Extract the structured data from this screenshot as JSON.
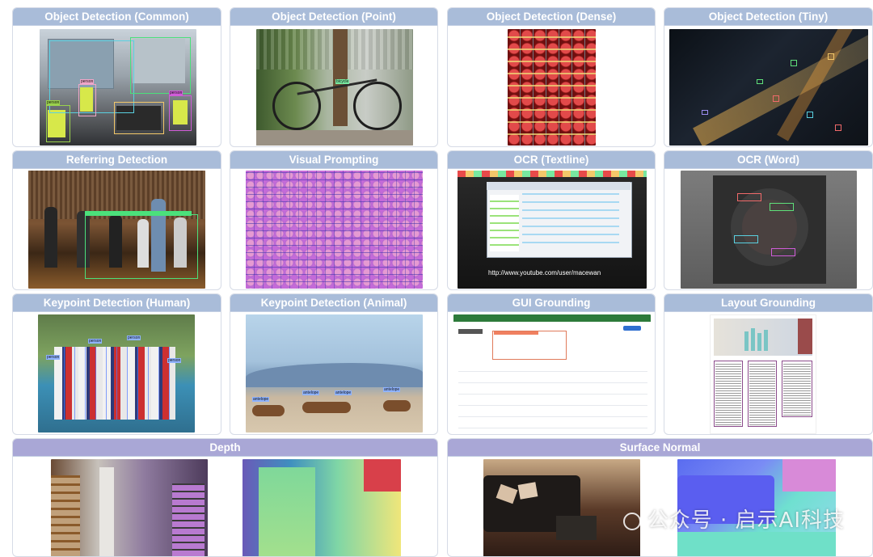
{
  "panels": {
    "obj_common": "Object Detection (Common)",
    "obj_point": "Object Detection (Point)",
    "obj_dense": "Object Detection (Dense)",
    "obj_tiny": "Object Detection (Tiny)",
    "referring": "Referring Detection",
    "visual_prompting": "Visual Prompting",
    "ocr_textline": "OCR (Textline)",
    "ocr_word": "OCR (Word)",
    "kp_human": "Keypoint Detection (Human)",
    "kp_animal": "Keypoint Detection (Animal)",
    "gui_grounding": "GUI Grounding",
    "layout_grounding": "Layout Grounding",
    "depth": "Depth",
    "surface_normal": "Surface Normal"
  },
  "labels": {
    "person": "person",
    "antelope": "antelope",
    "bicycle": "bicycle",
    "url": "http://www.youtube.com/user/macewan"
  },
  "watermark": "公众号 · 启示AI科技",
  "colors": {
    "header_blue": "#a9bcd9",
    "header_purple": "#a9a7d6"
  }
}
